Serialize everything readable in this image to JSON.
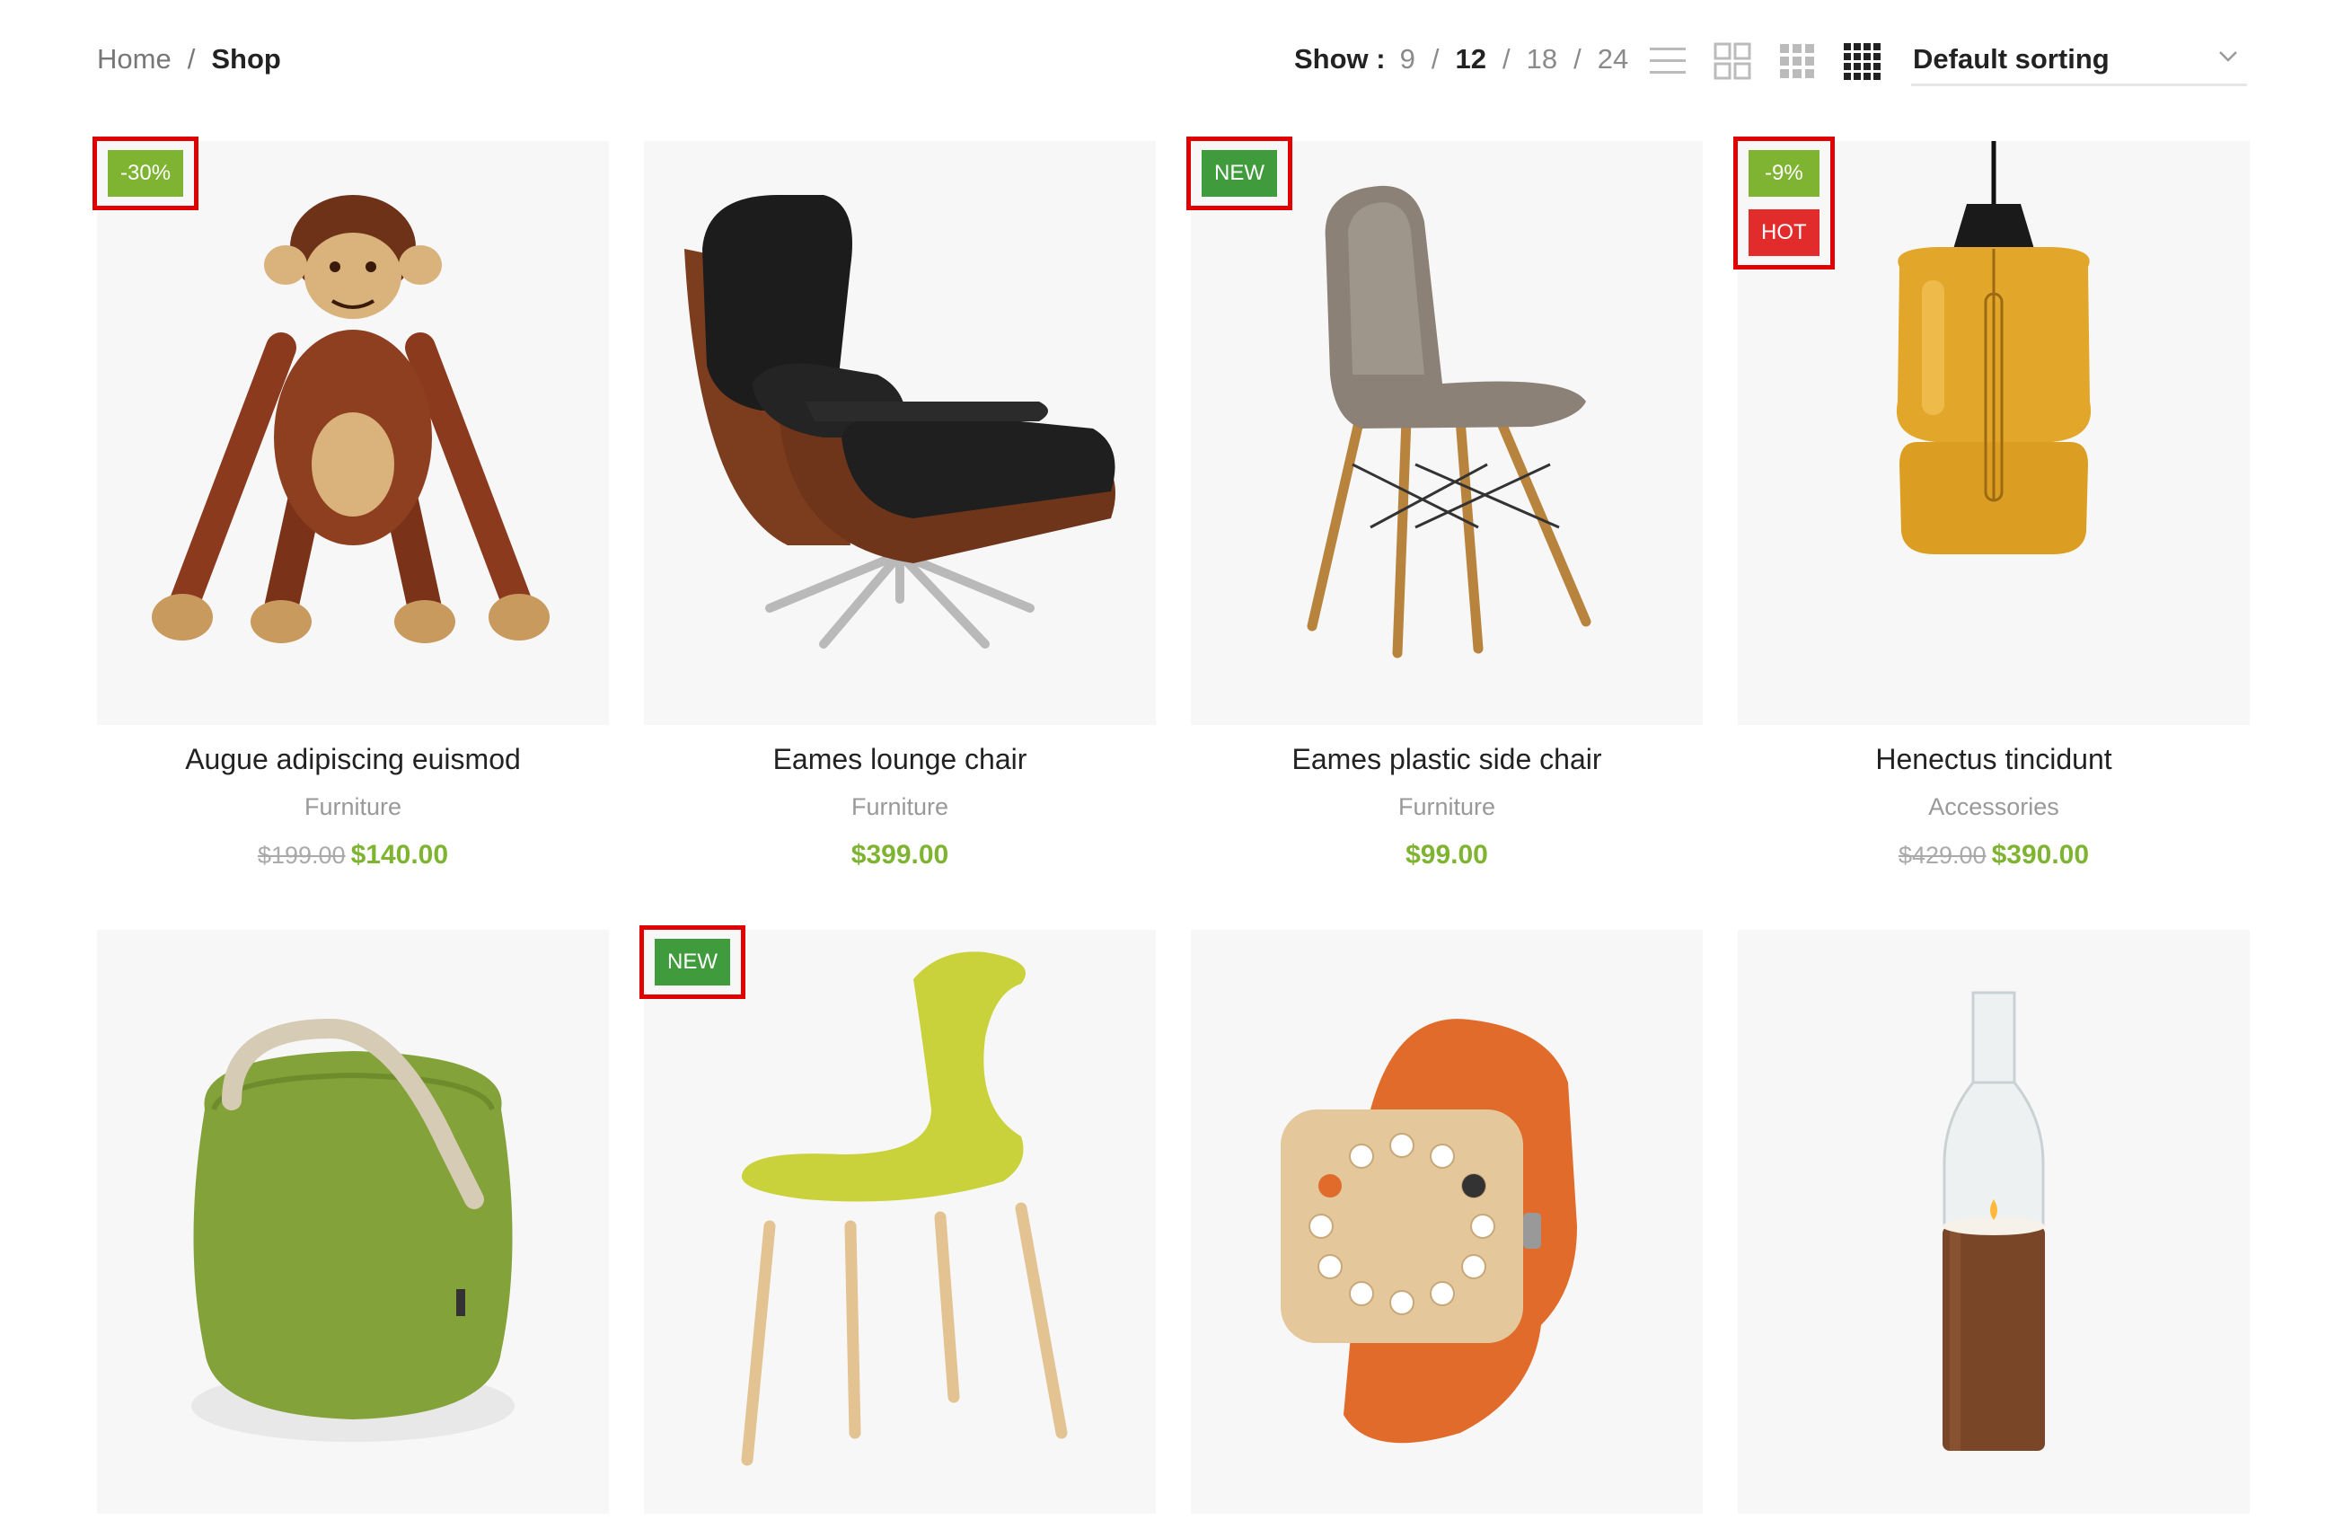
{
  "breadcrumb": {
    "home": "Home",
    "separator": "/",
    "current": "Shop"
  },
  "show": {
    "label": "Show :",
    "options": [
      "9",
      "12",
      "18",
      "24"
    ],
    "active": "12"
  },
  "view_icons": [
    "list-view-icon",
    "grid-2-icon",
    "grid-3-icon",
    "grid-4-icon"
  ],
  "sorting": {
    "selected": "Default sorting"
  },
  "colors": {
    "price": "#7fb433",
    "sale_badge": "#7fb433",
    "new_badge": "#3f9b3c",
    "hot_badge": "#e22b2b",
    "highlight_box": "#e10000"
  },
  "products": [
    {
      "title": "Augue adipiscing euismod",
      "category": "Furniture",
      "old_price": "$199.00",
      "price": "$140.00",
      "labels": [
        "-30%"
      ]
    },
    {
      "title": "Eames lounge chair",
      "category": "Furniture",
      "old_price": "",
      "price": "$399.00",
      "labels": []
    },
    {
      "title": "Eames plastic side chair",
      "category": "Furniture",
      "old_price": "",
      "price": "$99.00",
      "labels": [
        "NEW"
      ]
    },
    {
      "title": "Henectus tincidunt",
      "category": "Accessories",
      "old_price": "$429.00",
      "price": "$390.00",
      "labels": [
        "-9%",
        "HOT"
      ]
    },
    {
      "title": "",
      "category": "",
      "old_price": "",
      "price": "",
      "labels": []
    },
    {
      "title": "",
      "category": "",
      "old_price": "",
      "price": "",
      "labels": [
        "NEW"
      ]
    },
    {
      "title": "",
      "category": "",
      "old_price": "",
      "price": "",
      "labels": []
    },
    {
      "title": "",
      "category": "",
      "old_price": "",
      "price": "",
      "labels": []
    }
  ]
}
